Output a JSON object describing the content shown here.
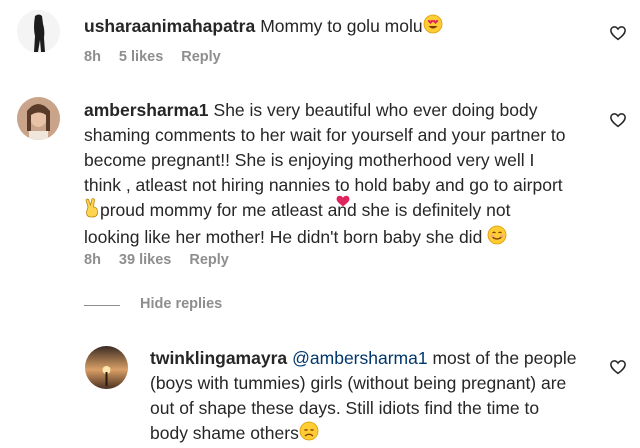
{
  "comments": [
    {
      "username": "usharaanimahapatra",
      "text": "Mommy to golu molu",
      "time": "8h",
      "likes": "5 likes",
      "reply": "Reply",
      "emoji": "heart-eyes-emoji"
    },
    {
      "username": "ambersharma1",
      "lines": [
        "She is very beautiful who ever doing body",
        "shaming comments to her wait for yourself and your partner to",
        "become pregnant!! She is enjoying motherhood very well I",
        "think , atleast not hiring nannies to hold baby and go to airport",
        "proud mommy for me atleast and she is definitely not",
        "looking like her mother! He didn't born baby she did"
      ],
      "time": "8h",
      "likes": "39 likes",
      "reply": "Reply",
      "emojis": [
        "victory-hand-emoji",
        "red-heart-emoji",
        "smiling-face-emoji"
      ]
    }
  ],
  "hide_replies": "Hide replies",
  "reply_comment": {
    "username": "twinklingamayra",
    "mention": "@ambersharma1",
    "lines": [
      "most of the people",
      "(boys with tummies) girls (without being pregnant) are",
      "out of shape these days. Still idiots find the time to",
      "body shame others"
    ],
    "emoji": "disappointed-face-emoji"
  }
}
